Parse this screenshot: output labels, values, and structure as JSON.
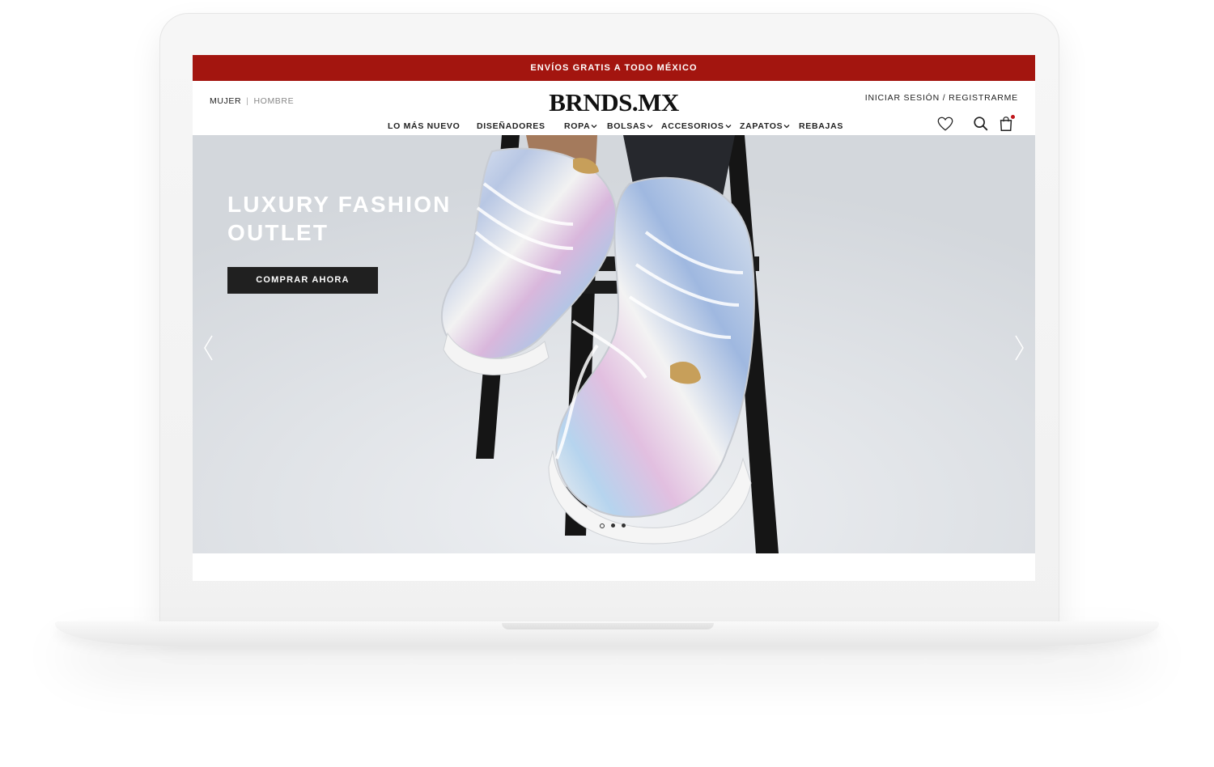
{
  "promo": {
    "text": "ENVÍOS GRATIS A TODO MÉXICO",
    "color": "#a3150f"
  },
  "header": {
    "gender": {
      "active": "MUJER",
      "separator": "|",
      "inactive": "HOMBRE"
    },
    "logo": "BRNDS.MX",
    "auth_label": "INICIAR SESIÓN / REGISTRARME",
    "nav": [
      {
        "label": "LO MÁS NUEVO",
        "dropdown": false
      },
      {
        "label": "DISEÑADORES",
        "dropdown": false
      },
      {
        "label": "ROPA",
        "dropdown": true
      },
      {
        "label": "BOLSAS",
        "dropdown": true
      },
      {
        "label": "ACCESORIOS",
        "dropdown": true
      },
      {
        "label": "ZAPATOS",
        "dropdown": true
      },
      {
        "label": "REBAJAS",
        "dropdown": false
      }
    ],
    "icons": [
      "heart-icon",
      "search-icon",
      "shopping-bag-icon"
    ]
  },
  "hero": {
    "title": "LUXURY FASHION OUTLET",
    "cta_label": "COMPRAR AHORA",
    "slides_total": 3,
    "active_slide": 1
  }
}
